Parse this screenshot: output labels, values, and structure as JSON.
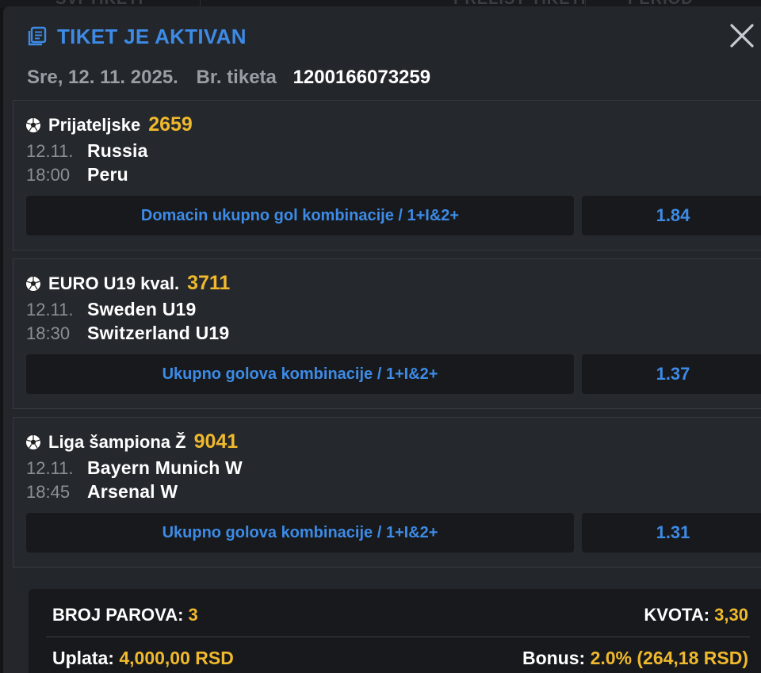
{
  "background": {
    "tabs": [
      "SVI TIKETI",
      "PRELIST TIKETI",
      "PERIOD"
    ]
  },
  "modal": {
    "title": "TIKET JE AKTIVAN",
    "date": "Sre, 12. 11. 2025.",
    "ticket_label": "Br. tiketa",
    "ticket_number": "1200166073259"
  },
  "matches": [
    {
      "league": "Prijateljske",
      "code": "2659",
      "date": "12.11.",
      "time": "18:00",
      "home": "Russia",
      "away": "Peru",
      "pick": "Domacin ukupno gol kombinacije / 1+I&2+",
      "odd": "1.84"
    },
    {
      "league": "EURO U19 kval.",
      "code": "3711",
      "date": "12.11.",
      "time": "18:30",
      "home": "Sweden U19",
      "away": "Switzerland U19",
      "pick": "Ukupno golova kombinacije / 1+I&2+",
      "odd": "1.37"
    },
    {
      "league": "Liga šampiona Ž",
      "code": "9041",
      "date": "12.11.",
      "time": "18:45",
      "home": "Bayern Munich W",
      "away": "Arsenal W",
      "pick": "Ukupno golova kombinacije / 1+I&2+",
      "odd": "1.31"
    }
  ],
  "summary": {
    "pairs_label": "BROJ PAROVA:",
    "pairs_value": "3",
    "odds_label": "KVOTA:",
    "odds_value": "3,30",
    "stake_label": "Uplata:",
    "stake_value": "4,000,00 RSD",
    "bonus_label": "Bonus:",
    "bonus_value": "2.0% (264,18 RSD)"
  },
  "colors": {
    "accent_blue": "#3d8be6",
    "accent_yellow": "#f0b92d",
    "panel": "#23262b",
    "card": "#25282d",
    "dark": "#17191c"
  },
  "icons": {
    "title_icon": "ticket-list-icon",
    "close_icon": "close-icon",
    "sport_icon": "soccer-ball-icon"
  }
}
